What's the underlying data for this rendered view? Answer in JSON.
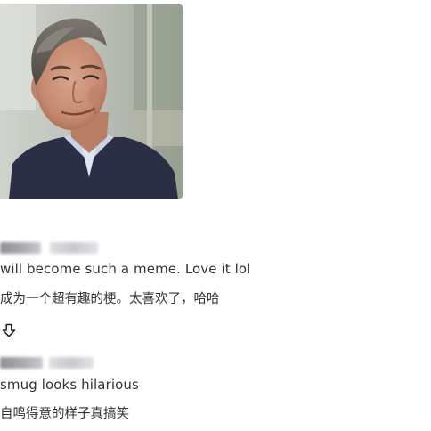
{
  "media": {
    "icon": "person-smirking-gif"
  },
  "comments": [
    {
      "text_en": "will become such a meme. Love it lol",
      "text_zh": "成为一个超有趣的梗。太喜欢了，哈哈",
      "vote_icon": "arrow-down-icon"
    },
    {
      "text_en": "smug looks hilarious",
      "text_zh": "自鸣得意的样子真搞笑"
    }
  ]
}
